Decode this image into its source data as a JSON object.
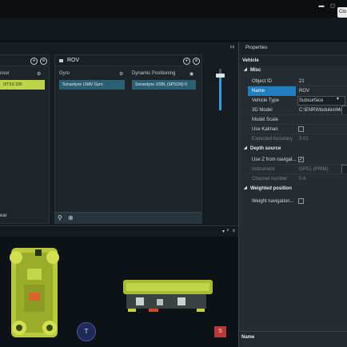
{
  "window": {
    "close_label": "Clo",
    "restore_icon": "restore-icon",
    "maximize_icon": "maximize-icon"
  },
  "panels": {
    "left": {
      "title": "",
      "col_label": "nsor",
      "sensor_value": "0/TSS 335",
      "bottom_label": "ear"
    },
    "rov": {
      "title": "ROV",
      "columns": [
        {
          "label": "Gyro",
          "value": "Sonardyne LNAV Gyro"
        },
        {
          "label": "Dynamic Positioning",
          "value": "Sonardyne USBL (SPSON) 0"
        }
      ]
    }
  },
  "viewport_controls": {
    "dropdown_arrow": "▾",
    "pin": "ᵖ",
    "close": "x"
  },
  "properties": {
    "title": "Properties",
    "category": "Vehicle",
    "sections": [
      {
        "title": "Misc",
        "rows": [
          {
            "label": "Object ID",
            "value": "21"
          },
          {
            "label": "Name",
            "value": "ROV"
          },
          {
            "label": "Vehicle Type",
            "value": "Subsurface"
          },
          {
            "label": "3D Model",
            "value": "C:\\ENR\\Modules\\Mo"
          },
          {
            "label": "Model Scale",
            "value": ""
          },
          {
            "label": "Use Kalman",
            "value": ""
          },
          {
            "label": "Expected Accuracy",
            "value": "0.01"
          }
        ]
      },
      {
        "title": "Depth source",
        "rows": [
          {
            "label": "Use Z from navigat...",
            "value": "✓"
          },
          {
            "label": "Instrument",
            "value": "GPS1 (PRIM)"
          },
          {
            "label": "Channel number",
            "value": "0 A"
          }
        ]
      },
      {
        "title": "Weighted position",
        "rows": [
          {
            "label": "Weight navigation...",
            "value": ""
          }
        ]
      }
    ],
    "footer": "Name"
  },
  "tools": {
    "translate": "T",
    "scale": "S"
  }
}
